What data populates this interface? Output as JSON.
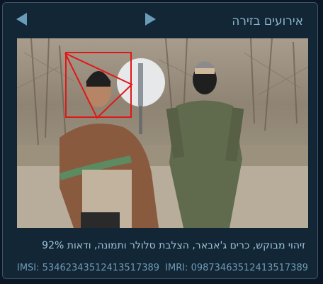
{
  "header": {
    "title": "אירועים בזירה",
    "prev_icon": "play-left-icon",
    "next_icon": "play-right-icon"
  },
  "event": {
    "caption": "זיהוי מבוקש, כרים ג'אבאר, הצלבת סלולר ותמונה, ודאות 92%",
    "imsi": "IMSI: 53462343512413517389",
    "imri": "IMRI: 09873463512413517389"
  },
  "colors": {
    "background": "#132635",
    "border": "#3d5468",
    "title": "#8ab4cc",
    "caption": "#9cc3da",
    "ids": "#6f9ab5",
    "highlight": "#e01818"
  }
}
